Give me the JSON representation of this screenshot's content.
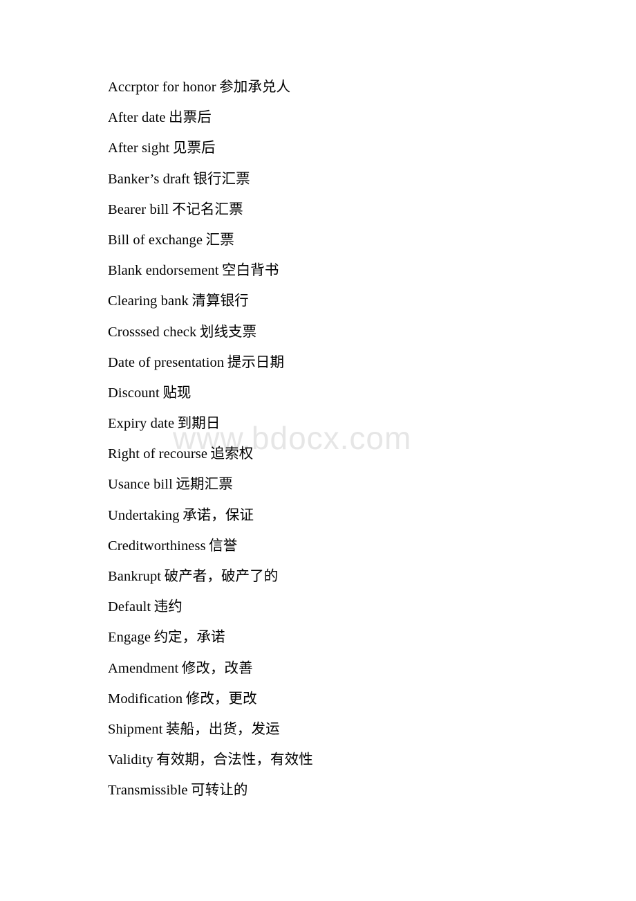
{
  "page": {
    "background_color": "#ffffff",
    "text_color": "#000000"
  },
  "watermark": {
    "text": "www.bdocx.com",
    "color": "#e6e6e6"
  },
  "glossary": {
    "entries": [
      {
        "term": "Accrptor for honor",
        "gloss": "参加承兑人"
      },
      {
        "term": "After date",
        "gloss": "出票后"
      },
      {
        "term": "After sight",
        "gloss": "见票后"
      },
      {
        "term": "Banker’s draft",
        "gloss": "银行汇票"
      },
      {
        "term": "Bearer bill",
        "gloss": "不记名汇票"
      },
      {
        "term": "Bill of exchange",
        "gloss": "汇票"
      },
      {
        "term": "Blank endorsement",
        "gloss": "空白背书"
      },
      {
        "term": "Clearing bank",
        "gloss": "清算银行"
      },
      {
        "term": "Crosssed check",
        "gloss": "划线支票"
      },
      {
        "term": "Date of presentation",
        "gloss": "提示日期"
      },
      {
        "term": "Discount",
        "gloss": "贴现"
      },
      {
        "term": "Expiry date",
        "gloss": "到期日"
      },
      {
        "term": "Right of recourse",
        "gloss": "追索权"
      },
      {
        "term": "Usance bill",
        "gloss": "远期汇票"
      },
      {
        "term": "Undertaking",
        "gloss": "承诺，保证"
      },
      {
        "term": "Creditworthiness",
        "gloss": "信誉"
      },
      {
        "term": "Bankrupt",
        "gloss": "破产者，破产了的"
      },
      {
        "term": "Default",
        "gloss": "违约"
      },
      {
        "term": "Engage",
        "gloss": "约定，承诺"
      },
      {
        "term": "Amendment",
        "gloss": "修改，改善"
      },
      {
        "term": "Modification",
        "gloss": "修改，更改"
      },
      {
        "term": "Shipment",
        "gloss": "装船，出货，发运"
      },
      {
        "term": "Validity",
        "gloss": "有效期，合法性，有效性"
      },
      {
        "term": "Transmissible",
        "gloss": "可转让的"
      }
    ]
  }
}
